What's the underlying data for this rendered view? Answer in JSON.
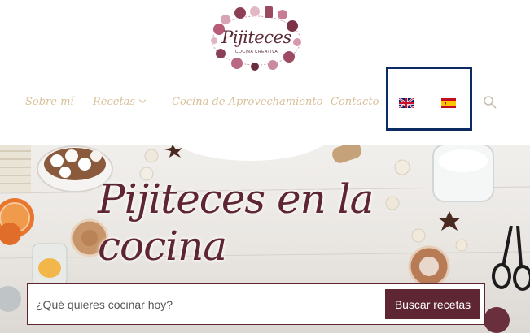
{
  "logo": {
    "name": "Pijiteces",
    "tagline": "COCINA CREATIVA"
  },
  "nav": {
    "items": [
      {
        "label": "Sobre mí"
      },
      {
        "label": "Recetas"
      },
      {
        "label": "Cocina de Aprovechamiento"
      },
      {
        "label": "Contacto"
      }
    ]
  },
  "languages": [
    {
      "icon": "uk-flag-icon"
    },
    {
      "icon": "spain-flag-icon"
    }
  ],
  "hero": {
    "title": "Pijiteces en la cocina"
  },
  "search": {
    "placeholder": "¿Qué quieres cocinar hoy?",
    "button_label": "Buscar recetas"
  },
  "colors": {
    "brand": "#5e2533",
    "nav_text": "#d7c09a",
    "highlight_border": "#0d2b63"
  }
}
